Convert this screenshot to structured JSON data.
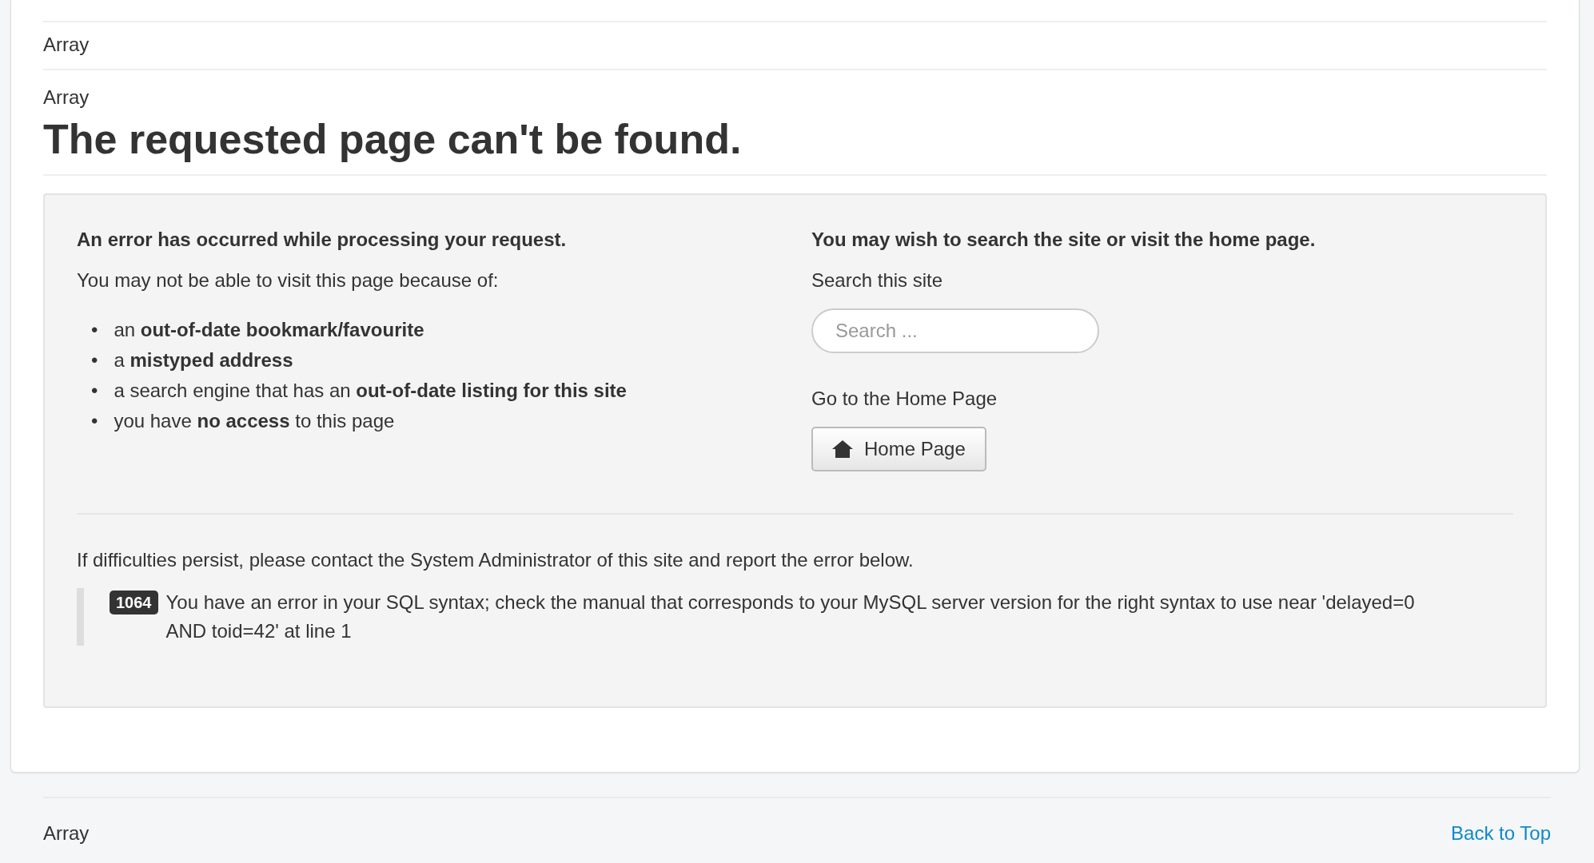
{
  "breadcrumbs_top": "Array",
  "breadcrumbs": "Array",
  "heading": "The requested page can't be found.",
  "error_panel": {
    "left": {
      "title": "An error has occurred while processing your request.",
      "intro": "You may not be able to visit this page because of:",
      "reasons": [
        {
          "bullet": "•",
          "text": "an **out-of-date bookmark/favourite**"
        },
        {
          "bullet": "•",
          "text": "a **mistyped address**"
        },
        {
          "bullet": "•",
          "text": "a search engine that has an **out-of-date listing for this site**"
        },
        {
          "bullet": "•",
          "text": "you have **no access** to this page"
        }
      ]
    },
    "right": {
      "title": "You may wish to search the site or visit the home page.",
      "search_label": "Search this site",
      "search": {
        "placeholder": "Search ..."
      },
      "home_label": "Go to the Home Page",
      "home_button": "Home Page"
    },
    "contact": "If difficulties persist, please contact the System Administrator of this site and report the error below.",
    "error": {
      "code": "1064",
      "message": "You have an error in your SQL syntax; check the manual that corresponds to your MySQL server version for the right syntax to use near 'delayed=0 AND toid=42' at line 1"
    }
  },
  "footer": {
    "text": "Array",
    "back_to_top": "Back to Top"
  }
}
